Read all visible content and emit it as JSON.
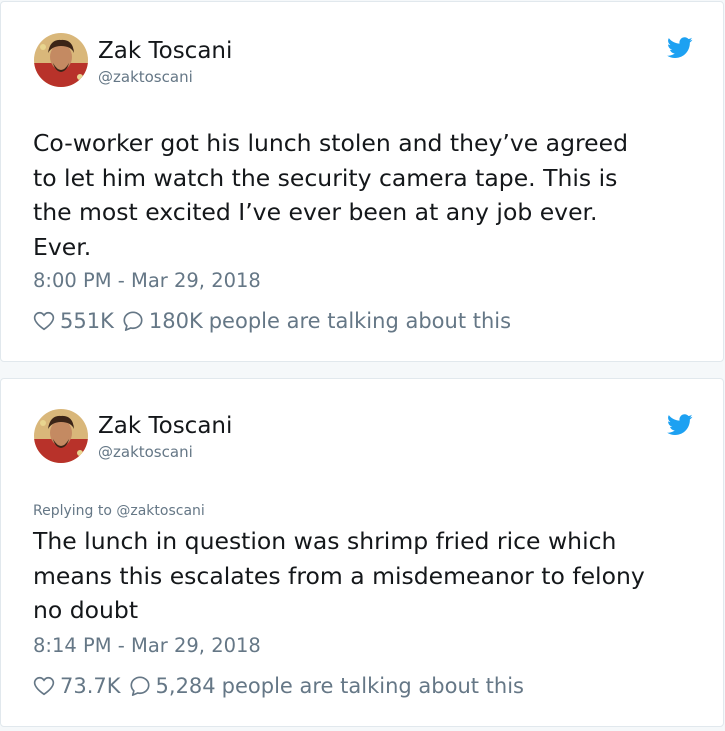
{
  "tweets": [
    {
      "author_name": "Zak Toscani",
      "author_handle": "@zaktoscani",
      "reply_to": "",
      "text_lines": [
        "Co-worker got his lunch stolen and they’ve agreed",
        "to let him watch the security camera tape. This is",
        "the most excited I’ve ever been at any job ever.",
        "Ever."
      ],
      "timestamp": "8:00 PM - Mar 29, 2018",
      "likes": "551K",
      "replies": "180K",
      "talking_label": "people are talking about this"
    },
    {
      "author_name": "Zak Toscani",
      "author_handle": "@zaktoscani",
      "reply_to": "Replying to @zaktoscani",
      "text_lines": [
        "The lunch in question was shrimp fried rice which",
        "means this escalates from a misdemeanor to felony",
        "no doubt"
      ],
      "timestamp": "8:14 PM - Mar 29, 2018",
      "likes": "73.7K",
      "replies": "5,284",
      "talking_label": "people are talking about this"
    }
  ],
  "icons": {
    "brand": "twitter-bird-icon",
    "like": "heart-icon",
    "reply": "speech-bubble-icon"
  },
  "colors": {
    "brand_blue": "#1da1f2",
    "text_primary": "#14171a",
    "text_secondary": "#657786",
    "border": "#e1e8ed",
    "background": "#f5f8fa"
  }
}
